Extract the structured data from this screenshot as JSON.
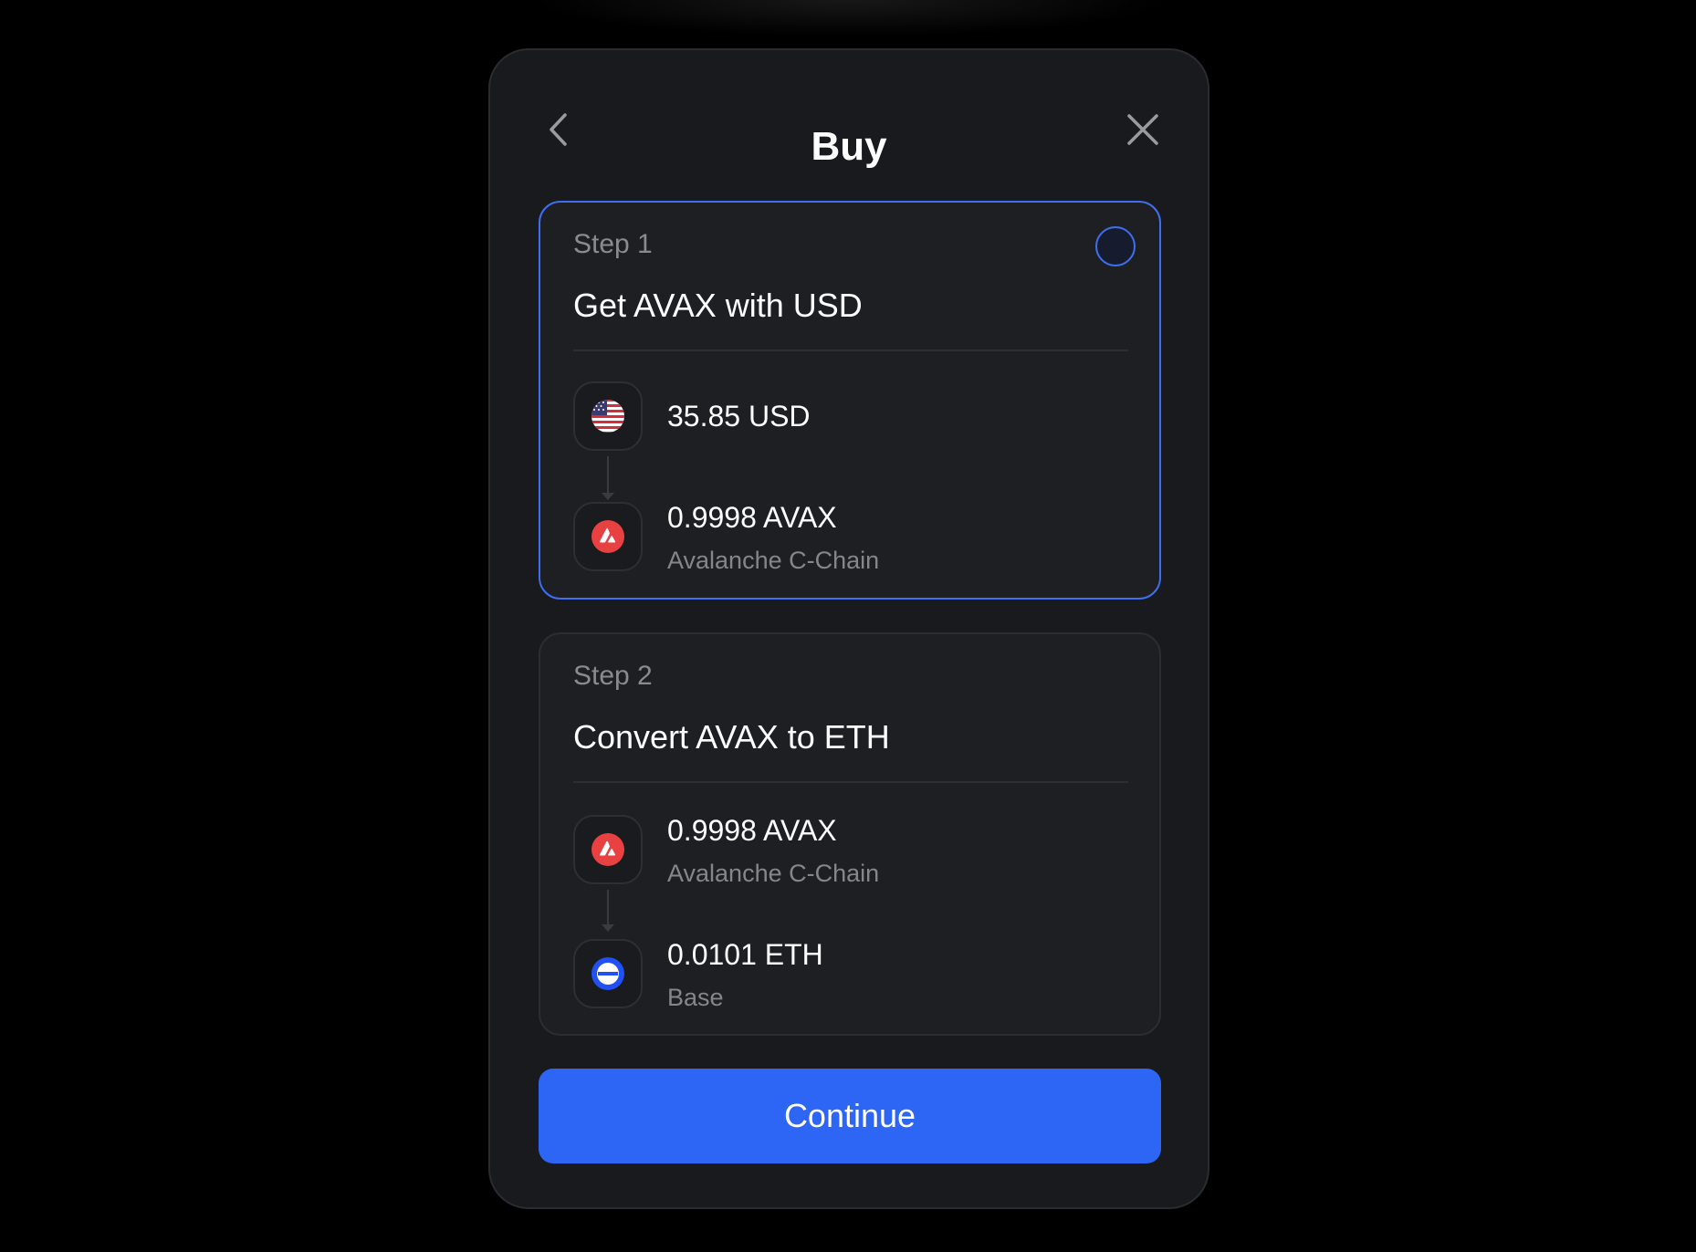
{
  "header": {
    "title": "Buy",
    "back_icon": "chevron-left-icon",
    "close_icon": "close-icon"
  },
  "steps": [
    {
      "label": "Step 1",
      "title": "Get AVAX with USD",
      "selected": false,
      "from": {
        "amount": "35.85 USD",
        "chain": "",
        "icon": "us-flag-icon"
      },
      "to": {
        "amount": "0.9998 AVAX",
        "chain": "Avalanche C-Chain",
        "icon": "avax-icon"
      }
    },
    {
      "label": "Step 2",
      "title": "Convert AVAX to ETH",
      "from": {
        "amount": "0.9998 AVAX",
        "chain": "Avalanche C-Chain",
        "icon": "avax-icon"
      },
      "to": {
        "amount": "0.0101 ETH",
        "chain": "Base",
        "icon": "base-icon"
      }
    }
  ],
  "continue_label": "Continue",
  "colors": {
    "accent": "#2d66f5",
    "active_border": "#3f6ff0",
    "avax_red": "#e84142",
    "base_blue": "#2151f5"
  }
}
